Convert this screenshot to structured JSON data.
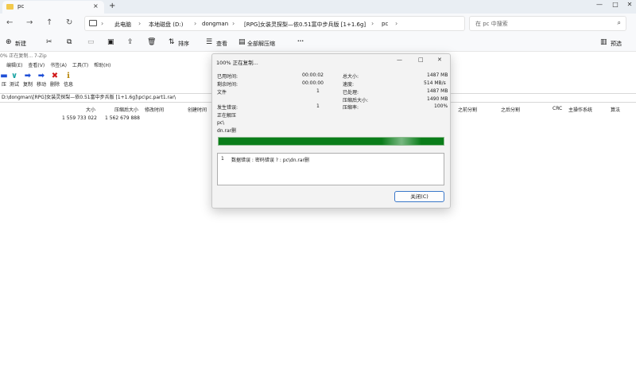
{
  "explorer": {
    "tab_title": "pc",
    "tab_close": "×",
    "new_tab": "+",
    "window_controls": [
      "—",
      "□",
      "✕"
    ],
    "nav": {
      "back": "←",
      "forward": "→",
      "up": "↑",
      "refresh": "↻"
    },
    "breadcrumb": [
      "此电脑",
      "本地磁盘 (D:)",
      "dongman",
      "[RPG]女装灵探梨—依0.51富中步兵版 [1+1.6g]",
      "pc"
    ],
    "search_placeholder": "在 pc 中搜索",
    "commands": {
      "new": "新建",
      "sort": "排序",
      "view": "查看",
      "extract_all": "全部解压缩",
      "more": "···",
      "preview": "预选"
    }
  },
  "zip": {
    "status": "0% 正在复制... 7-Zip",
    "menu": [
      "编辑(E)",
      "查看(V)",
      "书签(A)",
      "工具(T)",
      "帮助(H)"
    ],
    "tools": [
      {
        "label": "压",
        "icon": "add-icon"
      },
      {
        "label": "测试",
        "icon": "test-icon"
      },
      {
        "label": "复制",
        "icon": "copy-icon"
      },
      {
        "label": "移动",
        "icon": "move-icon"
      },
      {
        "label": "删除",
        "icon": "delete-icon"
      },
      {
        "label": "信息",
        "icon": "info-icon"
      }
    ],
    "path": "D:\\dongman\\[RPG]女装灵探梨—依0.51富中步兵版 [1+1.6g]\\pc\\pc.part1.rar\\",
    "columns": {
      "size": "大小",
      "packed": "压缩后大小",
      "modified": "修改时间",
      "created": "创建时间",
      "split_before": "之前分割",
      "split_after": "之后分割",
      "crc": "CRC",
      "host_os": "主操作系统",
      "method": "算法"
    },
    "row": {
      "size": "1 559 733 022",
      "packed": "1 562 679 888"
    }
  },
  "dialog": {
    "title": "100% 正在复制...",
    "labels": {
      "elapsed": "已用时间:",
      "remaining": "剩余时间:",
      "files": "文件",
      "total": "总大小:",
      "speed": "速度:",
      "processed": "已处理:",
      "compressed": "压缩后大小:",
      "errors": "发生错误:",
      "ratio": "压缩率:"
    },
    "values": {
      "elapsed": "00:00:02",
      "remaining": "00:00:00",
      "files": "1",
      "total": "1487 MB",
      "speed": "514 MB/s",
      "processed": "1487 MB",
      "compressed": "1490 MB",
      "errors": "1",
      "ratio": "100%"
    },
    "extracting": "正在解压",
    "current_dir": "pc\\",
    "current_file": "dn.rar删",
    "progress": 1.0,
    "error_row": {
      "num": "1",
      "text": "数据错误 : 密码错误 ? : pc\\dn.rar删"
    },
    "close_label": "关闭(C)",
    "colors": {
      "progress": "#0a7d1a",
      "button_border": "#3b78c9"
    }
  }
}
